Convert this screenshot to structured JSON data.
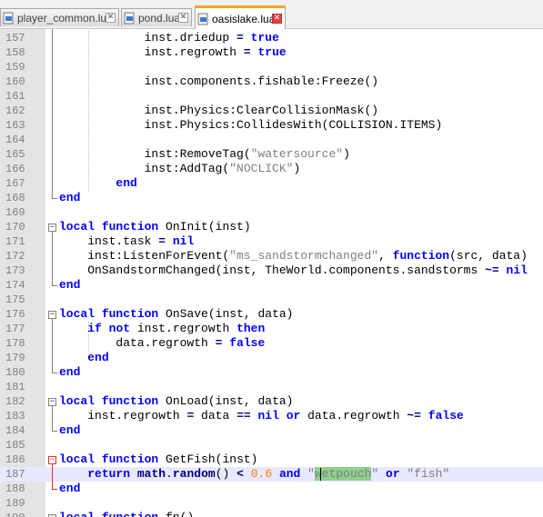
{
  "tabs": [
    {
      "label": "player_common.lua",
      "active": false
    },
    {
      "label": "pond.lua",
      "active": false
    },
    {
      "label": "oasislake.lua",
      "active": true
    }
  ],
  "tab_close_glyph": "✕",
  "colors": {
    "keyword": "#0000ff",
    "string": "#808080",
    "number": "#ff8000",
    "selection_highlight": "#8fcf8f",
    "current_line": "#e8e8ff",
    "active_tab_accent": "#f5a623"
  },
  "editor": {
    "current_line": 187,
    "lines": [
      {
        "n": "157",
        "text": "            inst.driedup = true"
      },
      {
        "n": "158",
        "text": "            inst.regrowth = true"
      },
      {
        "n": "159",
        "text": ""
      },
      {
        "n": "160",
        "text": "            inst.components.fishable:Freeze()"
      },
      {
        "n": "161",
        "text": ""
      },
      {
        "n": "162",
        "text": "            inst.Physics:ClearCollisionMask()"
      },
      {
        "n": "163",
        "text": "            inst.Physics:CollidesWith(COLLISION.ITEMS)"
      },
      {
        "n": "164",
        "text": ""
      },
      {
        "n": "165",
        "text": "            inst:RemoveTag(\"watersource\")"
      },
      {
        "n": "166",
        "text": "            inst:AddTag(\"NOCLICK\")"
      },
      {
        "n": "167",
        "text": "        end"
      },
      {
        "n": "168",
        "text": "end"
      },
      {
        "n": "169",
        "text": ""
      },
      {
        "n": "170",
        "text": "local function OnInit(inst)"
      },
      {
        "n": "171",
        "text": "    inst.task = nil"
      },
      {
        "n": "172",
        "text": "    inst:ListenForEvent(\"ms_sandstormchanged\", function(src, data)"
      },
      {
        "n": "173",
        "text": "    OnSandstormChanged(inst, TheWorld.components.sandstorms ~= nil"
      },
      {
        "n": "174",
        "text": "end"
      },
      {
        "n": "175",
        "text": ""
      },
      {
        "n": "176",
        "text": "local function OnSave(inst, data)"
      },
      {
        "n": "177",
        "text": "    if not inst.regrowth then"
      },
      {
        "n": "178",
        "text": "        data.regrowth = false"
      },
      {
        "n": "179",
        "text": "    end"
      },
      {
        "n": "180",
        "text": "end"
      },
      {
        "n": "181",
        "text": ""
      },
      {
        "n": "182",
        "text": "local function OnLoad(inst, data)"
      },
      {
        "n": "183",
        "text": "    inst.regrowth = data == nil or data.regrowth ~= false"
      },
      {
        "n": "184",
        "text": "end"
      },
      {
        "n": "185",
        "text": ""
      },
      {
        "n": "186",
        "text": "local function GetFish(inst)"
      },
      {
        "n": "187",
        "text": "    return math.random() < 0.6 and \"wetpouch\" or \"fish\""
      },
      {
        "n": "188",
        "text": "end"
      },
      {
        "n": "189",
        "text": ""
      },
      {
        "n": "190",
        "text": "local function fn()"
      }
    ]
  }
}
